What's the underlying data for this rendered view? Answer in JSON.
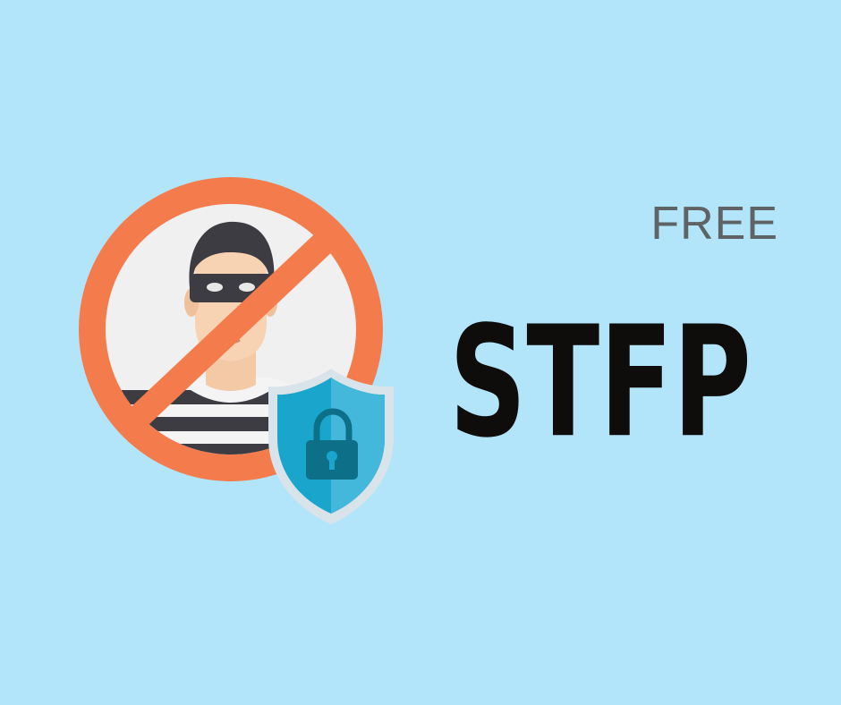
{
  "badge": {
    "small_label": "FREE",
    "title": "STFP"
  },
  "illustration": {
    "prohibition_color": "#f47c4c",
    "shield_color": "#19a5cc",
    "icons": [
      "no-thief-icon",
      "shield-lock-icon"
    ]
  },
  "colors": {
    "background": "#b2e4fa",
    "title": "#0f0c0c",
    "small_label": "#5f6366"
  }
}
